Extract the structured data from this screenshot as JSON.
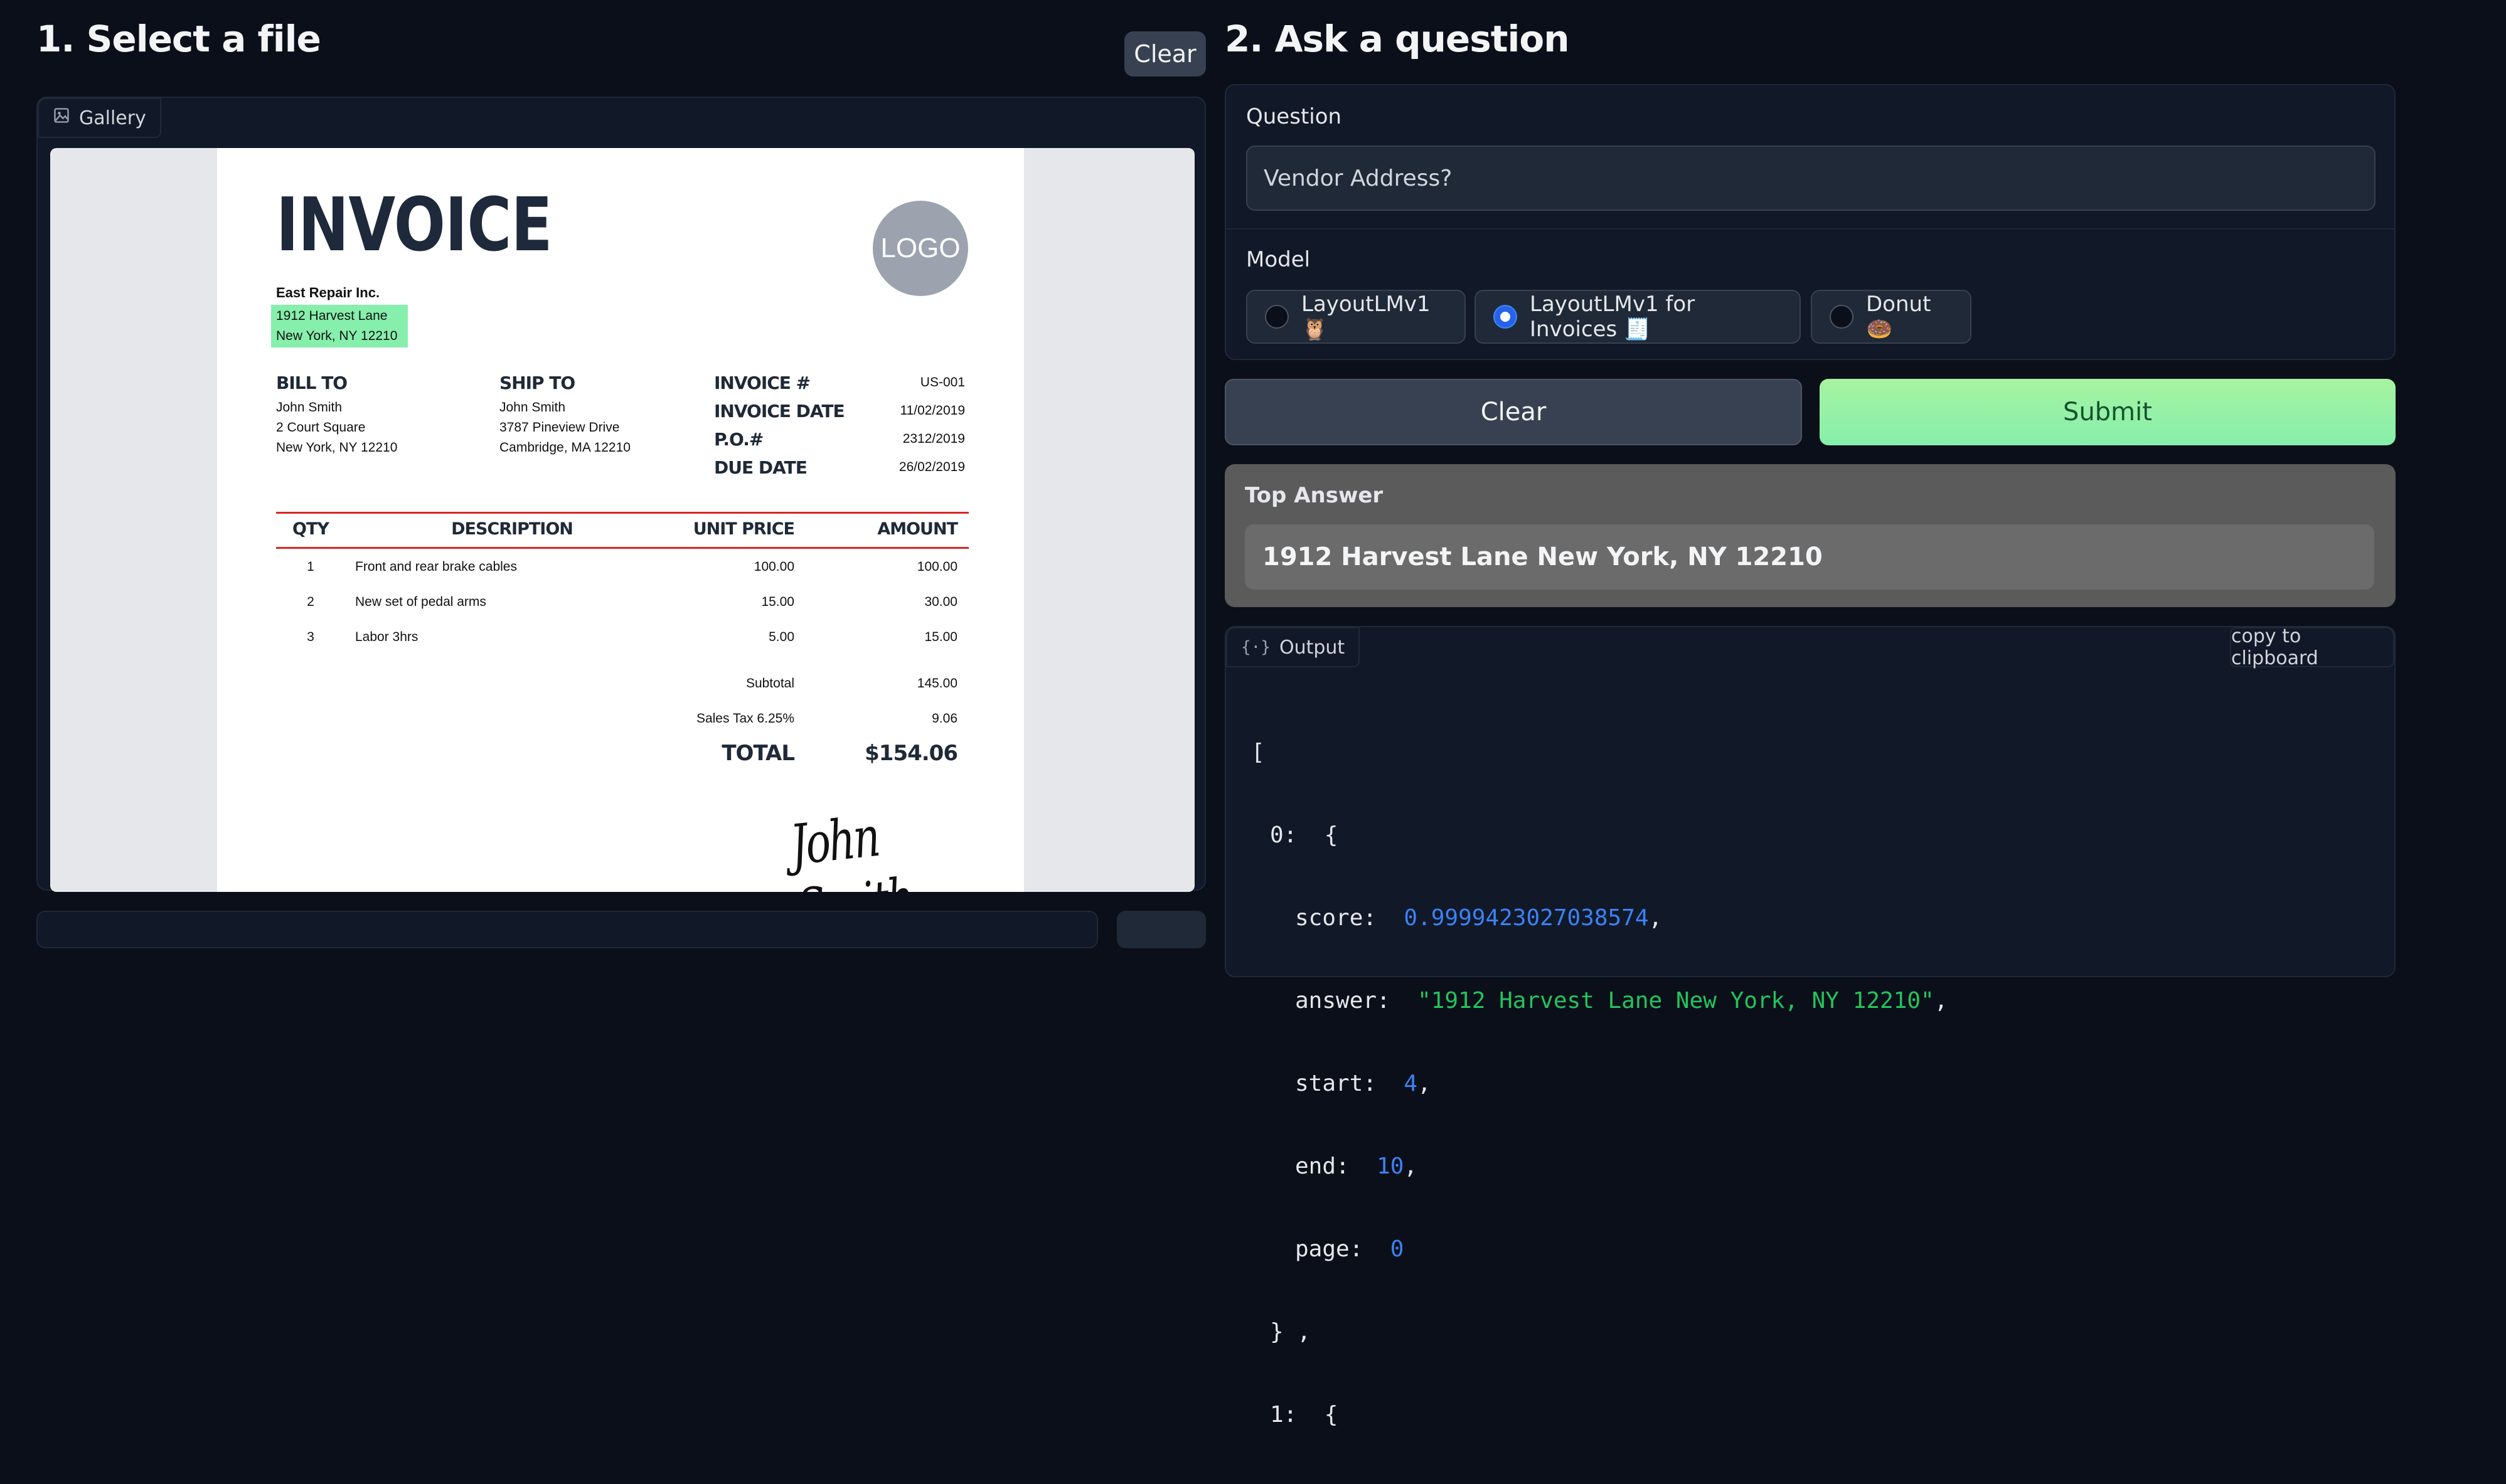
{
  "left": {
    "heading": "1. Select a file",
    "clear_label": "Clear",
    "gallery_label": "Gallery",
    "gallery_icon": "image-icon"
  },
  "invoice": {
    "title": "INVOICE",
    "logo": "LOGO",
    "vendor_name": "East Repair Inc.",
    "vendor_line1": "1912 Harvest Lane",
    "vendor_line2": "New York, NY 12210",
    "bill_to": {
      "heading": "BILL TO",
      "l1": "John Smith",
      "l2": "2 Court Square",
      "l3": "New York, NY 12210"
    },
    "ship_to": {
      "heading": "SHIP TO",
      "l1": "John Smith",
      "l2": "3787 Pineview Drive",
      "l3": "Cambridge, MA 12210"
    },
    "meta": [
      {
        "label": "INVOICE #",
        "value": "US-001"
      },
      {
        "label": "INVOICE DATE",
        "value": "11/02/2019"
      },
      {
        "label": "P.O.#",
        "value": "2312/2019"
      },
      {
        "label": "DUE DATE",
        "value": "26/02/2019"
      }
    ],
    "columns": {
      "qty": "QTY",
      "desc": "DESCRIPTION",
      "unit": "UNIT PRICE",
      "amount": "AMOUNT"
    },
    "rows": [
      {
        "qty": "1",
        "desc": "Front and rear brake cables",
        "unit": "100.00",
        "amount": "100.00"
      },
      {
        "qty": "2",
        "desc": "New set of pedal arms",
        "unit": "15.00",
        "amount": "30.00"
      },
      {
        "qty": "3",
        "desc": "Labor 3hrs",
        "unit": "5.00",
        "amount": "15.00"
      }
    ],
    "subtotal_label": "Subtotal",
    "subtotal": "145.00",
    "tax_label": "Sales Tax 6.25%",
    "tax": "9.06",
    "total_label": "TOTAL",
    "total": "$154.06",
    "signature": "John Smith",
    "highlight_color": "#86efac",
    "accent_red": "#dc2626"
  },
  "right": {
    "heading": "2. Ask a question",
    "question_label": "Question",
    "question_value": "Vendor Address?",
    "model_label": "Model",
    "models": [
      {
        "label": "LayoutLMv1 🦉",
        "selected": false
      },
      {
        "label": "LayoutLMv1 for Invoices 🧾",
        "selected": true
      },
      {
        "label": "Donut 🍩",
        "selected": false
      }
    ],
    "clear_label": "Clear",
    "submit_label": "Submit",
    "top_answer_label": "Top Answer",
    "top_answer_value": "1912 Harvest Lane New York, NY 12210",
    "output_label": "Output",
    "output_icon": "braces-icon",
    "copy_label": "copy to clipboard",
    "json": {
      "open_bracket": "[",
      "item0_key": "0:",
      "open_brace": "{",
      "score_key": "score:",
      "score": "0.9999423027038574",
      "answer_key": "answer:",
      "answer": "\"1912 Harvest Lane New York, NY 12210\"",
      "start_key": "start:",
      "start": "4",
      "end_key": "end:",
      "end": "10",
      "page_key": "page:",
      "page": "0",
      "close_brace": "} ,",
      "item1_key": "1:",
      "open_brace2": "{"
    }
  },
  "colors": {
    "background": "#0b0f19",
    "panel": "#111827",
    "submit_bg": "#86efac",
    "submit_text": "#14532d",
    "radio_selected": "#2563eb"
  }
}
